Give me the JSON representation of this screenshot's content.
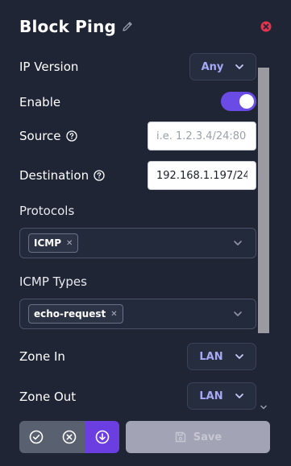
{
  "panel": {
    "title": "Block Ping"
  },
  "fields": {
    "ip_version": {
      "label": "IP Version",
      "value": "Any"
    },
    "enable": {
      "label": "Enable",
      "on": true
    },
    "source": {
      "label": "Source",
      "value": "",
      "placeholder": "i.e. 1.2.3.4/24:80"
    },
    "destination": {
      "label": "Destination",
      "value": "192.168.1.197/24",
      "placeholder": ""
    },
    "protocols": {
      "label": "Protocols",
      "chips": [
        "ICMP"
      ]
    },
    "icmp_types": {
      "label": "ICMP Types",
      "chips": [
        "echo-request"
      ]
    },
    "zone_in": {
      "label": "Zone In",
      "value": "LAN"
    },
    "zone_out": {
      "label": "Zone Out",
      "value": "LAN"
    }
  },
  "footer": {
    "save_label": "Save"
  },
  "colors": {
    "background": "#1f2535",
    "accent": "#6a4be6",
    "select_text": "#a6a9f5",
    "close_red": "#e0344f"
  },
  "icons": [
    "pencil-icon",
    "close-circle-icon",
    "help-circle-icon",
    "chevron-down-icon",
    "check-circle-icon",
    "x-circle-icon",
    "download-circle-icon",
    "save-disk-icon"
  ]
}
